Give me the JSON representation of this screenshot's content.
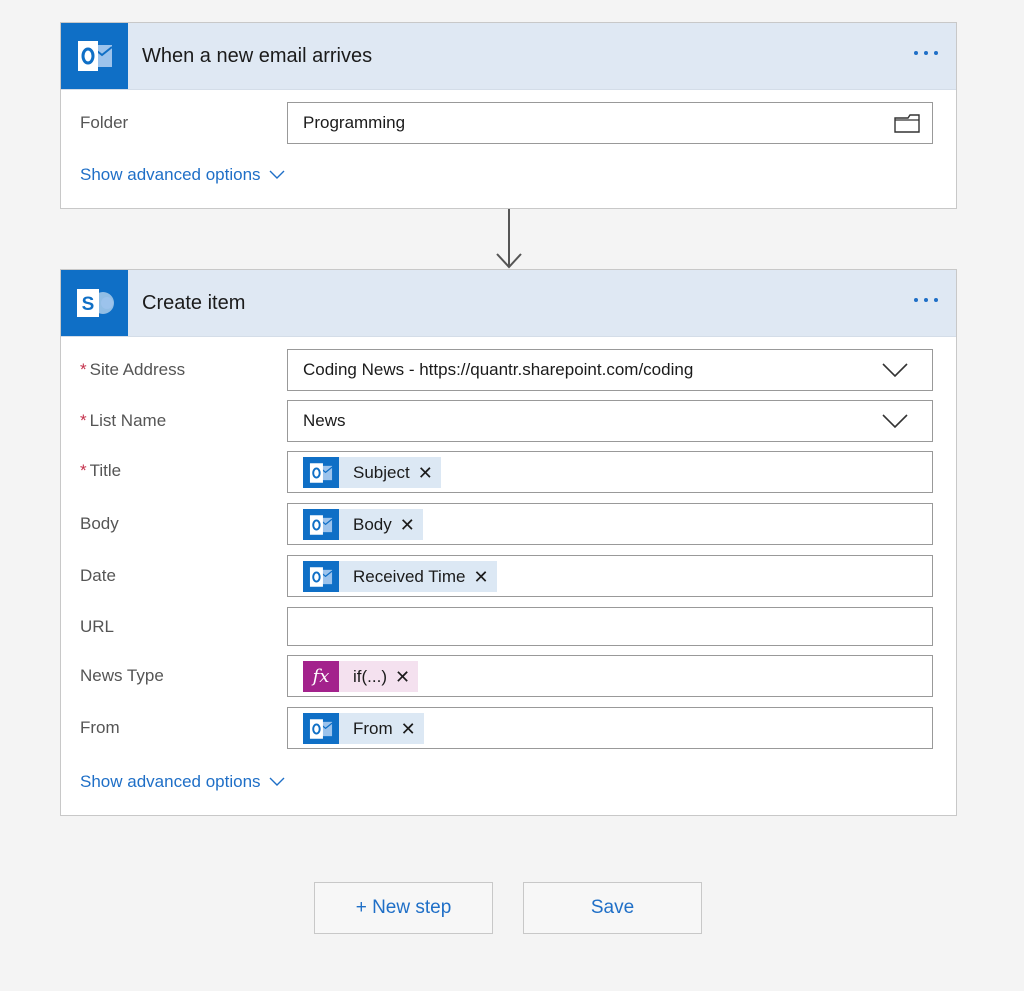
{
  "trigger_card": {
    "icon": "outlook-icon",
    "title": "When a new email arrives",
    "fields": {
      "folder": {
        "label": "Folder",
        "value": "Programming",
        "icon": "folder-picker-icon"
      }
    },
    "advanced_label": "Show advanced options"
  },
  "action_card": {
    "icon": "sharepoint-icon",
    "title": "Create item",
    "fields": {
      "site_address": {
        "label": "Site Address",
        "required_marker": "*",
        "value": "Coding News - https://quantr.sharepoint.com/coding"
      },
      "list_name": {
        "label": "List Name",
        "required_marker": "*",
        "value": "News"
      },
      "title": {
        "label": "Title",
        "required_marker": "*",
        "token": "Subject",
        "token_icon": "outlook-icon"
      },
      "body": {
        "label": "Body",
        "token": "Body",
        "token_icon": "outlook-icon"
      },
      "date": {
        "label": "Date",
        "token": "Received Time",
        "token_icon": "outlook-icon"
      },
      "url": {
        "label": "URL",
        "value": ""
      },
      "news_type": {
        "label": "News Type",
        "token": "if(...)",
        "token_icon": "fx-icon",
        "fx_glyph": "fx"
      },
      "from": {
        "label": "From",
        "token": "From",
        "token_icon": "outlook-icon"
      }
    },
    "advanced_label": "Show advanced options"
  },
  "token_remove_glyph": "✕",
  "footer": {
    "new_step_label": "+ New step",
    "save_label": "Save"
  },
  "colors": {
    "accent": "#1f6fc7",
    "outlook": "#0f6fc6",
    "expression": "#a3228c",
    "header_bg": "#dfe8f3",
    "required": "#c4314b"
  }
}
